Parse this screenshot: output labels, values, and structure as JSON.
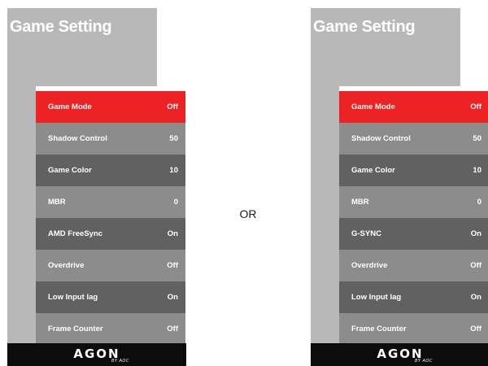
{
  "separator": "OR",
  "colors": {
    "selected": "#ed2224",
    "row_dark": "#616162",
    "row_light": "#8c8c8d",
    "panel_bg": "#b8b8b9",
    "brand_bar": "#0c0c0c"
  },
  "panels": [
    {
      "title": "Game Setting",
      "items": [
        {
          "label": "Game Mode",
          "value": "Off",
          "selected": true
        },
        {
          "label": "Shadow Control",
          "value": "50"
        },
        {
          "label": "Game Color",
          "value": "10"
        },
        {
          "label": "MBR",
          "value": "0"
        },
        {
          "label": "AMD FreeSync",
          "value": "On"
        },
        {
          "label": "Overdrive",
          "value": "Off"
        },
        {
          "label": "Low Input lag",
          "value": "On"
        },
        {
          "label": "Frame Counter",
          "value": "Off"
        }
      ],
      "brand": "AGON",
      "brand_sub": "BY AOC"
    },
    {
      "title": "Game Setting",
      "items": [
        {
          "label": "Game Mode",
          "value": "Off",
          "selected": true
        },
        {
          "label": "Shadow Control",
          "value": "50"
        },
        {
          "label": "Game Color",
          "value": "10"
        },
        {
          "label": "MBR",
          "value": "0"
        },
        {
          "label": "G-SYNC",
          "value": "On"
        },
        {
          "label": "Overdrive",
          "value": "Off"
        },
        {
          "label": "Low Input lag",
          "value": "On"
        },
        {
          "label": "Frame Counter",
          "value": "Off"
        }
      ],
      "brand": "AGON",
      "brand_sub": "BY AOC"
    }
  ]
}
